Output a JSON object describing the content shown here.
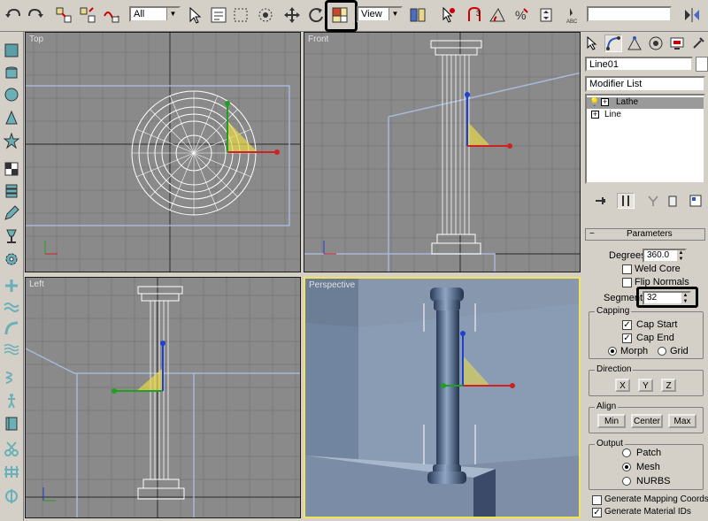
{
  "toolbar": {
    "selection_filter": "All",
    "reference_coord": "View",
    "named_selection": "",
    "accent": "#000000"
  },
  "viewports": [
    {
      "label": "Top"
    },
    {
      "label": "Front"
    },
    {
      "label": "Left"
    },
    {
      "label": "Perspective",
      "active_border": "#f2e35a"
    }
  ],
  "command_panel": {
    "object_name": "Line01",
    "object_color": "#ffffff",
    "modifier_list": "Modifier List",
    "stack": [
      {
        "label": "Lathe",
        "selected": true
      },
      {
        "label": "Line",
        "selected": false
      }
    ],
    "parameters": {
      "title": "Parameters",
      "degrees_label": "Degrees:",
      "degrees_value": "360.0",
      "weld_core": "Weld Core",
      "flip_normals": "Flip Normals",
      "segments_label": "Segments:",
      "segments_value": "32",
      "capping": {
        "title": "Capping",
        "cap_start": "Cap Start",
        "cap_end": "Cap End",
        "morph": "Morph",
        "grid": "Grid"
      },
      "direction": {
        "title": "Direction",
        "x": "X",
        "y": "Y",
        "z": "Z"
      },
      "align": {
        "title": "Align",
        "min": "Min",
        "center": "Center",
        "max": "Max"
      },
      "output": {
        "title": "Output",
        "patch": "Patch",
        "mesh": "Mesh",
        "nurbs": "NURBS"
      },
      "gen_mapping": "Generate Mapping Coords.",
      "gen_material": "Generate Material IDs"
    }
  }
}
